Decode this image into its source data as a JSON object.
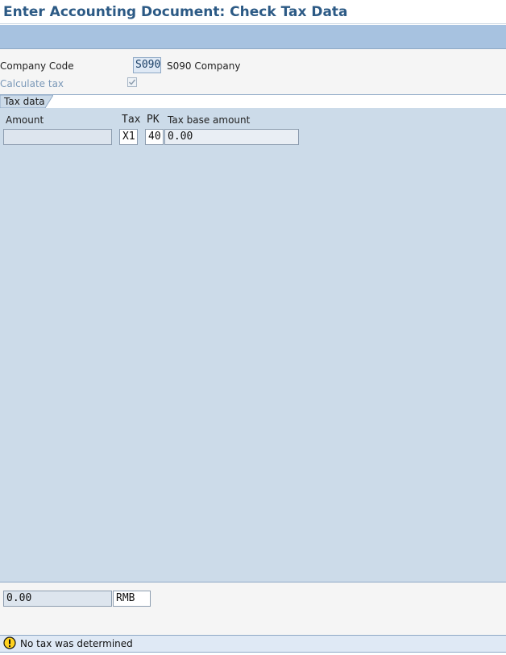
{
  "window": {
    "title": "Enter Accounting Document: Check Tax Data"
  },
  "header": {
    "company_code_label": "Company Code",
    "company_code_value": "S090",
    "company_name": "S090 Company",
    "calculate_tax_label": "Calculate tax",
    "calculate_tax_checked": true
  },
  "tabs": [
    {
      "label": "Tax data",
      "active": true
    }
  ],
  "tax_table": {
    "columns": {
      "amount": "Amount",
      "tax": "Tax",
      "pk": "PK",
      "tax_base_amount": "Tax base amount"
    },
    "rows": [
      {
        "amount": "",
        "tax": "X1",
        "pk": "40",
        "tax_base_amount": "0.00"
      }
    ]
  },
  "totals": {
    "amount": "0.00",
    "currency": "RMB"
  },
  "status": {
    "icon": "warning-icon",
    "message": "No tax was determined"
  },
  "colors": {
    "title": "#2c5a85",
    "toolbar": "#a7c2e0",
    "panel": "#ccdbe9",
    "status_bar": "#dfe9f5"
  }
}
